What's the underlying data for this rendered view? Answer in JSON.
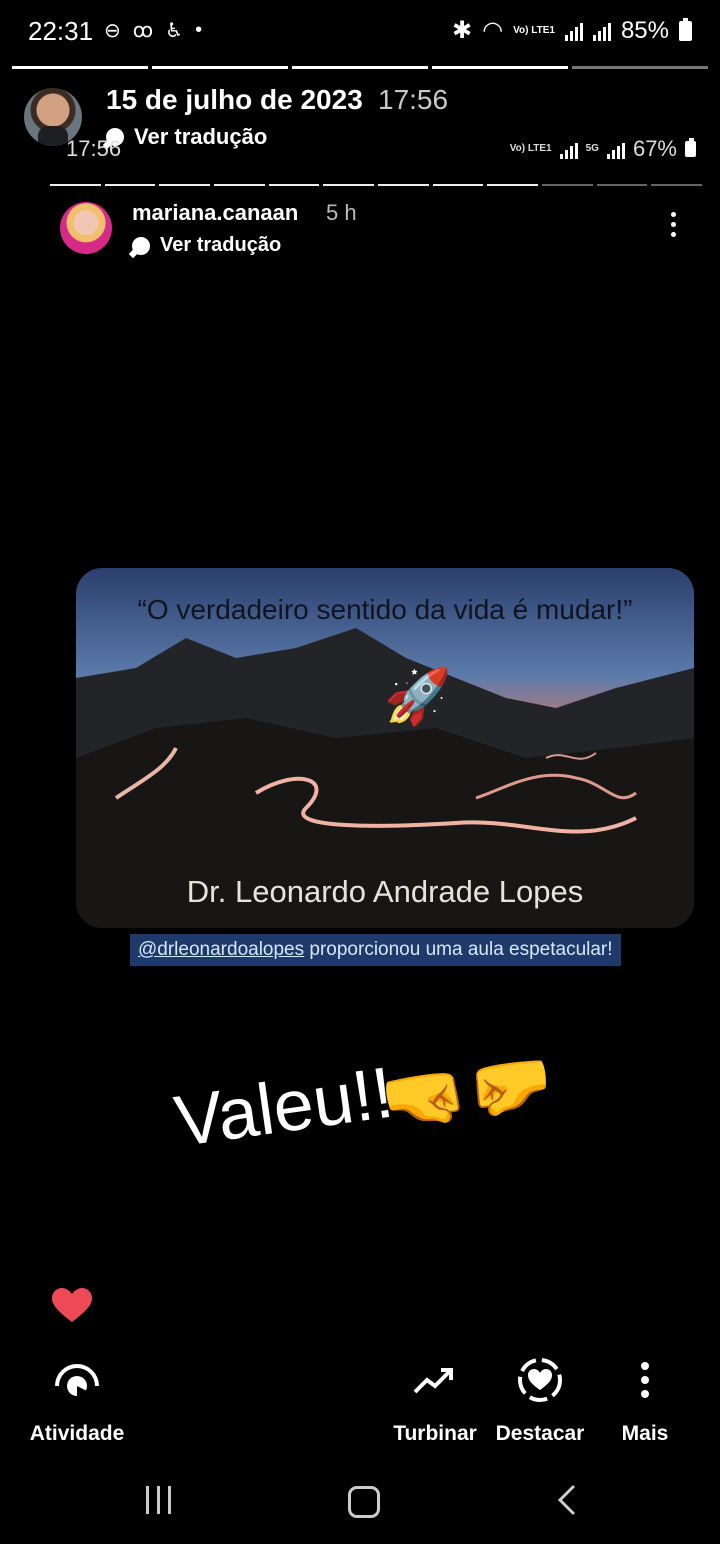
{
  "status_bar": {
    "time": "22:31",
    "battery": "85%",
    "lte_label": "Vo) LTE1",
    "icons": [
      "do-not-disturb-icon",
      "voicemail-icon",
      "accessibility-icon",
      "dot-icon",
      "bluetooth-icon",
      "wifi-icon",
      "signal-icon",
      "battery-icon"
    ]
  },
  "story": {
    "date": "15 de julho de 2023",
    "time": "17:56",
    "translate_label": "Ver tradução",
    "segments_total": 12,
    "segments_active": 11
  },
  "embedded": {
    "status_time": "17:56",
    "status_battery": "67%",
    "status_lte": "Vo) LTE1",
    "status_5g": "5G",
    "username": "mariana.canaan",
    "age": "5 h",
    "translate_label": "Ver tradução",
    "quote": "“O verdadeiro sentido da vida é mudar!”",
    "author": "Dr. Leonardo Andrade Lopes",
    "caption_mention": "@drleonardoalopes",
    "caption_text": " proporcionou uma aula espetacular!",
    "sticker_text": "Valeu!!",
    "sticker_emoji": "🤜🤛",
    "rocket_emoji": "🚀"
  },
  "actions": {
    "like_color": "#ed4956",
    "atividade": "Atividade",
    "turbinar": "Turbinar",
    "destacar": "Destacar",
    "mais": "Mais"
  },
  "nav": {
    "icons": [
      "recents-icon",
      "home-icon",
      "back-icon"
    ]
  }
}
